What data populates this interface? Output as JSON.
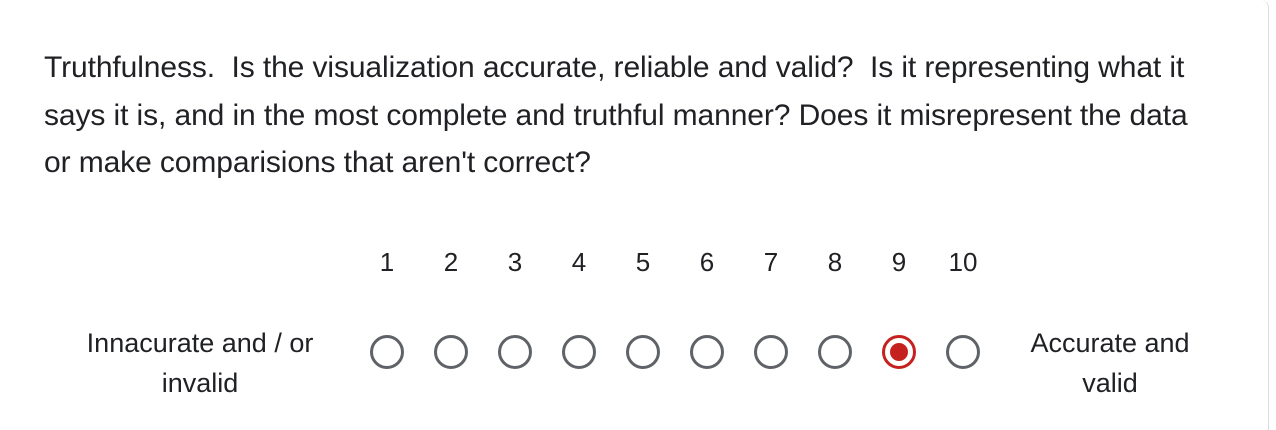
{
  "question": {
    "text": "Truthfulness.  Is the visualization accurate, reliable and valid?  Is it representing what it says it is, and in the most complete and truthful manner? Does it misrepresent the data or make comparisions that aren't correct?"
  },
  "scale": {
    "low_label": "Innacurate and / or invalid",
    "high_label": "Accurate and valid",
    "options": [
      "1",
      "2",
      "3",
      "4",
      "5",
      "6",
      "7",
      "8",
      "9",
      "10"
    ],
    "selected": "9"
  },
  "colors": {
    "selected": "#c5221f",
    "unselected": "#5f6368",
    "text": "#202124"
  }
}
